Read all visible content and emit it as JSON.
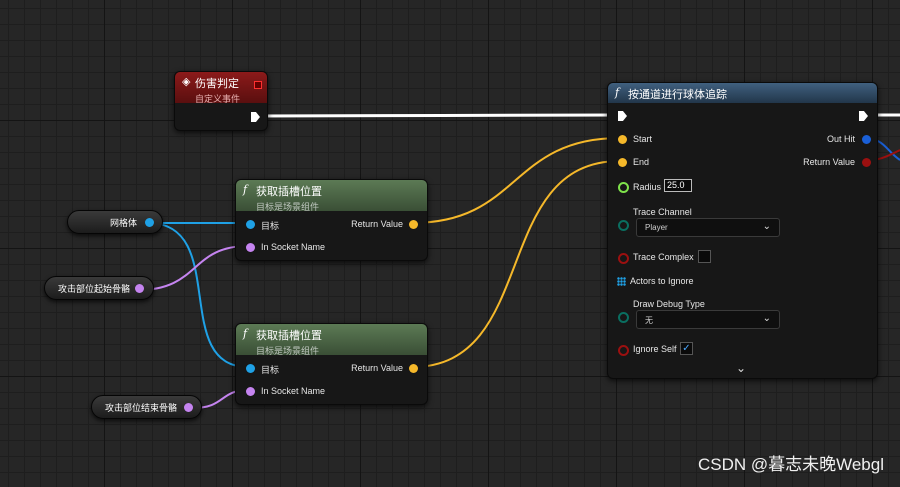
{
  "custom_event": {
    "title": "伤害判定",
    "subtitle": "自定义事件"
  },
  "trace_node": {
    "title": "按通道进行球体追踪",
    "pins": {
      "start": "Start",
      "end": "End",
      "radius": "Radius",
      "trace_channel": "Trace Channel",
      "trace_complex": "Trace Complex",
      "actors_to_ignore": "Actors to Ignore",
      "draw_debug_type": "Draw Debug Type",
      "ignore_self": "Ignore Self",
      "out_hit": "Out Hit",
      "return_value": "Return Value"
    },
    "radius_value": "25.0",
    "trace_channel_value": "Player",
    "draw_debug_value": "无",
    "ignore_self_checked": true,
    "trace_complex_checked": false
  },
  "socket_node_1": {
    "title": "获取插槽位置",
    "subtitle": "目标是场景组件",
    "pin_target": "目标",
    "pin_socket": "In Socket Name",
    "pin_return": "Return Value"
  },
  "socket_node_2": {
    "title": "获取插槽位置",
    "subtitle": "目标是场景组件",
    "pin_target": "目标",
    "pin_socket": "In Socket Name",
    "pin_return": "Return Value"
  },
  "variables": {
    "mesh": "网格体",
    "start_bone": "攻击部位起始骨骼",
    "end_bone": "攻击部位结束骨骼"
  },
  "watermark": "CSDN @暮志未晚Webgl",
  "colors": {
    "exec": "#ffffff",
    "vector": "#f5b82a",
    "object": "#1fa1e6",
    "name": "#c584f0",
    "float": "#7fe34b",
    "struct": "#1a5fd6",
    "bool": "#9b1010",
    "enum": "#0a6e60",
    "event_header": "#7a1515",
    "function_header": "#3a5a78",
    "pure_header": "#4e6a48"
  }
}
